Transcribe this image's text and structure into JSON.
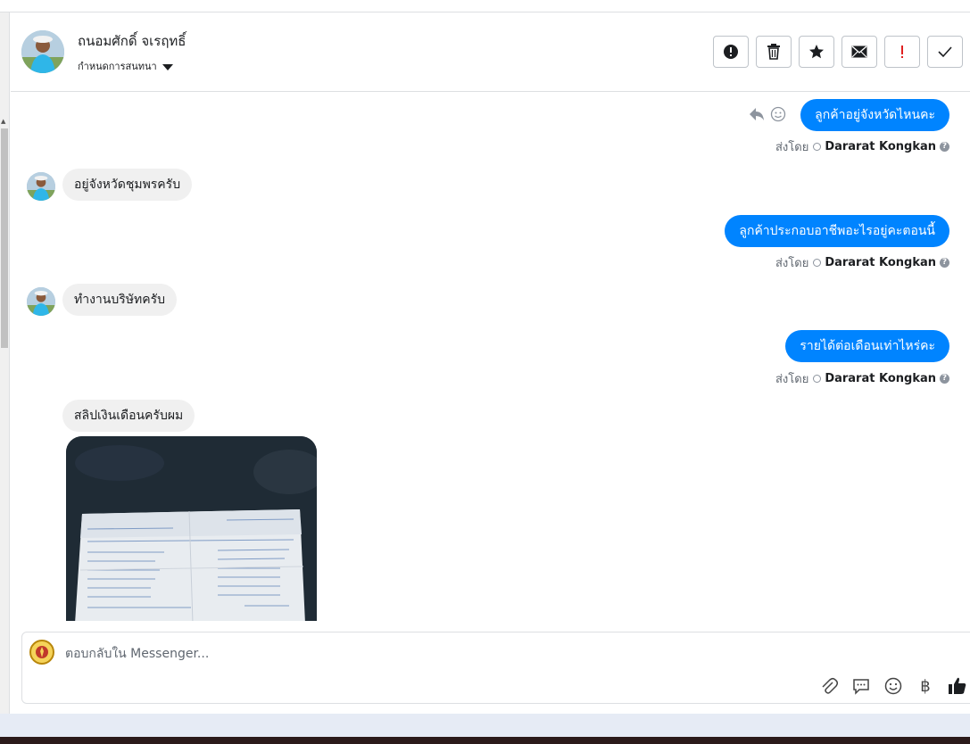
{
  "header": {
    "contact_name": "ถนอมศักดิ์ จเรฤทธิ์",
    "conversation_settings": "กำหนดการสนทนา",
    "toolbar": {
      "buttons": [
        {
          "icon": "alert-circle-icon"
        },
        {
          "icon": "trash-icon"
        },
        {
          "icon": "star-icon"
        },
        {
          "icon": "envelope-icon"
        },
        {
          "icon": "exclamation-icon"
        },
        {
          "icon": "check-icon"
        }
      ],
      "exclamation_color": "#e02020"
    }
  },
  "thread": {
    "messages": [
      {
        "direction": "outgoing",
        "text": "ลูกค้าอยู่จังหวัดไหนคะ",
        "sent_by_label": "ส่งโดย",
        "agent": "Dararat Kongkan",
        "help": "?"
      },
      {
        "direction": "incoming",
        "text": "อยู่จังหวัดชุมพรครับ"
      },
      {
        "direction": "outgoing",
        "text": "ลูกค้าประกอบอาชีพอะไรอยู่คะตอนนี้",
        "sent_by_label": "ส่งโดย",
        "agent": "Dararat Kongkan",
        "help": "?"
      },
      {
        "direction": "incoming",
        "text": "ทำงานบริษัทครับ"
      },
      {
        "direction": "outgoing",
        "text": "รายได้ต่อเดือนเท่าไหร่คะ",
        "sent_by_label": "ส่งโดย",
        "agent": "Dararat Kongkan",
        "help": "?"
      },
      {
        "direction": "incoming",
        "text": "สลิปเงินเดือนครับผม"
      },
      {
        "direction": "incoming",
        "type": "image",
        "alt": "pay slip photo"
      }
    ],
    "accent_color": "#0084ff"
  },
  "composer": {
    "placeholder": "ตอบกลับใน Messenger...",
    "tools": [
      "paperclip-icon",
      "chat-bubble-icon",
      "smiley-icon",
      "baht-icon",
      "thumbs-up-icon"
    ],
    "baht_symbol": "฿"
  }
}
